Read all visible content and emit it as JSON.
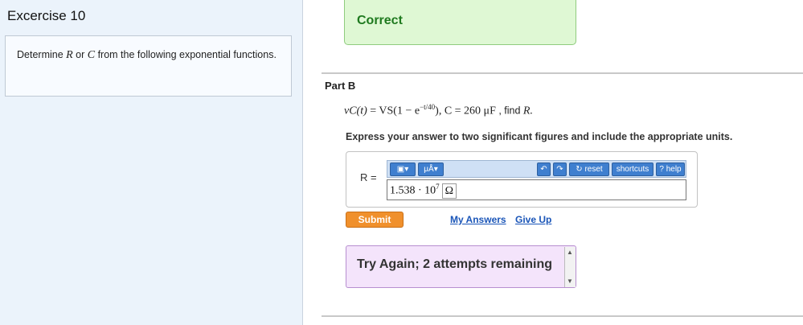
{
  "sidebar": {
    "title": "Excercise 10",
    "problem": {
      "p1": "Determine ",
      "var_r": "R",
      "or": " or ",
      "var_c": "C",
      "p2": " from the following exponential functions."
    }
  },
  "feedback": {
    "correct": "Correct",
    "try_again": "Try Again; 2 attempts remaining"
  },
  "part": {
    "label": "Part B"
  },
  "question": {
    "lhs": "vC(t)",
    "eq": " = VS(1 − e",
    "exponent": "−t/40",
    "close": "), ",
    "c_eq": "C = 260 μF",
    "find": " , find ",
    "target": "R."
  },
  "instruction": "Express your answer to two significant figures and include the appropriate units.",
  "answer": {
    "label": "R =",
    "value": "1.538 · 10",
    "exponent": "7",
    "unit": "Ω"
  },
  "toolbar": {
    "templates_label": "▣▾",
    "units_label": "μÅ▾",
    "undo_label": "↶",
    "redo_label": "↷",
    "reset_label": "↻ reset",
    "shortcuts_label": "shortcuts",
    "help_label": "? help"
  },
  "actions": {
    "submit": "Submit",
    "my_answers": "My Answers",
    "give_up": "Give Up"
  },
  "colors": {
    "correct_bg": "#dff8d4",
    "try_bg": "#f4e4fb",
    "submit": "#f0902c",
    "toolbar_btn": "#3f7fcf"
  }
}
